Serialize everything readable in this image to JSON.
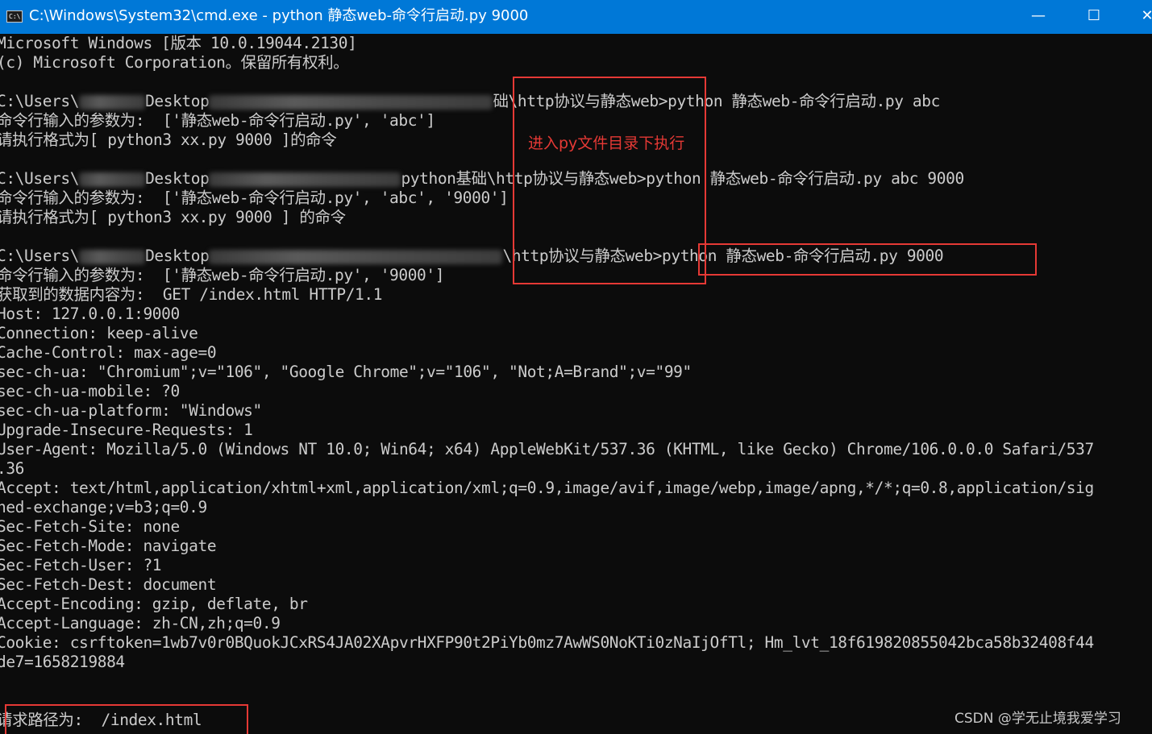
{
  "window": {
    "title": "C:\\Windows\\System32\\cmd.exe - python  静态web-命令行启动.py 9000",
    "icon": "cmd-icon",
    "controls": {
      "minimize": "—",
      "maximize": "☐",
      "close": "✕"
    }
  },
  "console": {
    "lines": [
      "Microsoft Windows [版本 10.0.19044.2130]",
      "(c) Microsoft Corporation。保留所有权利。",
      "",
      "",
      "命令行输入的参数为:  ['静态web-命令行启动.py', 'abc']",
      "请执行格式为[ python3 xx.py 9000 ]的命令",
      "",
      "",
      "命令行输入的参数为:  ['静态web-命令行启动.py', 'abc', '9000']",
      "请执行格式为[ python3 xx.py 9000 ] 的命令",
      "",
      "",
      "命令行输入的参数为:  ['静态web-命令行启动.py', '9000']",
      "获取到的数据内容为:  GET /index.html HTTP/1.1",
      "Host: 127.0.0.1:9000",
      "Connection: keep-alive",
      "Cache-Control: max-age=0",
      "sec-ch-ua: \"Chromium\";v=\"106\", \"Google Chrome\";v=\"106\", \"Not;A=Brand\";v=\"99\"",
      "sec-ch-ua-mobile: ?0",
      "sec-ch-ua-platform: \"Windows\"",
      "Upgrade-Insecure-Requests: 1",
      "User-Agent: Mozilla/5.0 (Windows NT 10.0; Win64; x64) AppleWebKit/537.36 (KHTML, like Gecko) Chrome/106.0.0.0 Safari/537",
      ".36",
      "Accept: text/html,application/xhtml+xml,application/xml;q=0.9,image/avif,image/webp,image/apng,*/*;q=0.8,application/sig",
      "ned-exchange;v=b3;q=0.9",
      "Sec-Fetch-Site: none",
      "Sec-Fetch-Mode: navigate",
      "Sec-Fetch-User: ?1",
      "Sec-Fetch-Dest: document",
      "Accept-Encoding: gzip, deflate, br",
      "Accept-Language: zh-CN,zh;q=0.9",
      "Cookie: csrftoken=1wb7v0r0BQuokJCxRS4JA02XApvrHXFP90t2PiYb0mz7AwWS0NoKTi0zNaIjOfTl; Hm_lvt_18f619820855042bca58b32408f44",
      "de7=1658219884",
      "",
      "",
      "请求路径为:  /index.html"
    ],
    "prompts": [
      {
        "prefix": "C:\\Users\\",
        "desktop": "Desktop",
        "folder_hint": "",
        "path_tail": "础\\http协议与静态web>",
        "command": "python 静态web-命令行启动.py abc"
      },
      {
        "prefix": "C:\\Users\\",
        "desktop": "Desktop",
        "folder_hint": "python基础",
        "path_tail": "\\http协议与静态web>",
        "command": "python 静态web-命令行启动.py abc 9000"
      },
      {
        "prefix": "C:\\Users\\",
        "desktop": "Desktop",
        "folder_hint": "",
        "path_tail": "\\http协议与静态web>",
        "command": "python 静态web-命令行启动.py 9000"
      }
    ]
  },
  "annotation": {
    "note": "进入py文件目录下执行",
    "color": "#e53935"
  },
  "watermark": "CSDN @学无止境我爱学习",
  "colors": {
    "titlebar": "#0078d7",
    "console_bg": "#0c0c0c",
    "console_text": "#cccccc",
    "annotation": "#e53935"
  }
}
